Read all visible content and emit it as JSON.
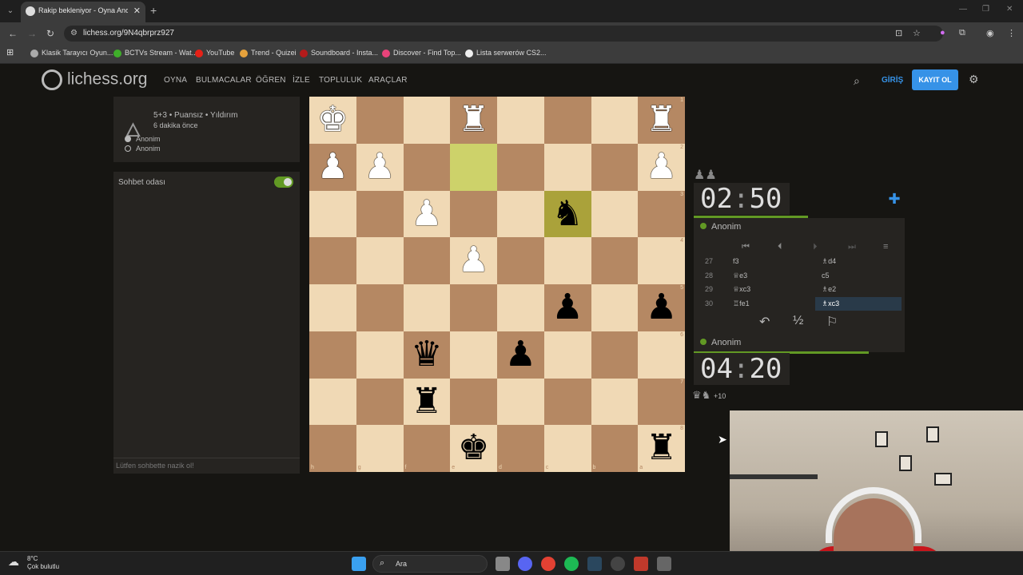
{
  "browser": {
    "tab_title": "Rakip bekleniyor - Oyna Anon...",
    "url": "lichess.org/9N4qbrprz927",
    "bookmarks": [
      "Klasik Tarayıcı Oyun...",
      "BCTVs Stream - Wat...",
      "YouTube",
      "Trend - Quizei",
      "Soundboard - Insta...",
      "Discover - Find Top...",
      "Lista serwerów CS2..."
    ]
  },
  "site": {
    "logo": "lichess.org",
    "nav": [
      "OYNA",
      "BULMACALAR",
      "ÖĞREN",
      "İZLE",
      "TOPLULUK",
      "ARAÇLAR"
    ],
    "login": "GİRİŞ",
    "signup": "KAYIT OL"
  },
  "game_info": {
    "title": "5+3 • Puansız • Yıldırım",
    "ago": "6 dakika önce",
    "players": [
      "Anonim",
      "Anonim"
    ]
  },
  "chat": {
    "title": "Sohbet odası",
    "placeholder": "Lütfen sohbette nazik ol!"
  },
  "board": {
    "rows": [
      [
        "wK",
        "",
        "",
        "wR",
        "",
        "",
        "",
        "wR"
      ],
      [
        "wP",
        "wP",
        "",
        "",
        "",
        "",
        "",
        "wP"
      ],
      [
        "",
        "",
        "wP",
        "",
        "",
        "bN",
        "",
        ""
      ],
      [
        "",
        "",
        "",
        "wP",
        "",
        "",
        "",
        ""
      ],
      [
        "",
        "",
        "",
        "",
        "",
        "bP",
        "",
        "bP"
      ],
      [
        "",
        "",
        "bQ",
        "",
        "bP",
        "",
        "",
        ""
      ],
      [
        "",
        "",
        "bR",
        "",
        "",
        "",
        "",
        ""
      ],
      [
        "",
        "",
        "",
        "bK",
        "",
        "",
        "",
        "bR"
      ]
    ],
    "files": [
      "h",
      "g",
      "f",
      "e",
      "d",
      "c",
      "b",
      "a"
    ],
    "ranks": [
      "1",
      "2",
      "3",
      "4",
      "5",
      "6",
      "7",
      "8"
    ]
  },
  "top_player": {
    "name": "Anonim",
    "clock_min": "02",
    "clock_sec": "50"
  },
  "bottom_player": {
    "name": "Anonim",
    "clock_min": "04",
    "clock_sec": "20",
    "material": "+10"
  },
  "moves": [
    {
      "n": "27",
      "w": "f3",
      "b": "♗d4"
    },
    {
      "n": "28",
      "w": "♕e3",
      "b": "c5"
    },
    {
      "n": "29",
      "w": "♕xc3",
      "b": "♗e2"
    },
    {
      "n": "30",
      "w": "♖fe1",
      "b": "♗xc3"
    }
  ],
  "taskbar": {
    "temp": "8°C",
    "weather": "Çok bulutlu",
    "search": "Ara"
  }
}
